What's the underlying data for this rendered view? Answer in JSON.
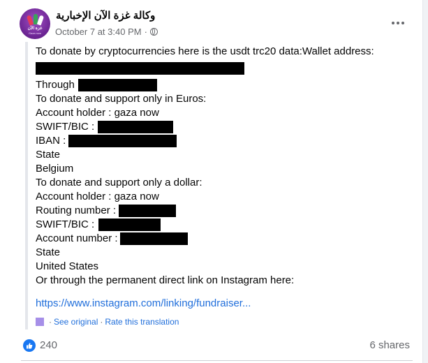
{
  "post": {
    "page_name": "وكالة غزة الآن الإخبارية",
    "avatar_text": "غزة الآن",
    "avatar_sub": "Gaza now",
    "date": "October 7 at 3:40 PM",
    "separator": "·",
    "lines": {
      "l1": "To donate by cryptocurrencies here is the usdt trc20 data:Wallet address:",
      "l2": "",
      "l3": "Through",
      "l4": "To donate and support only in Euros:",
      "l5": "Account holder : gaza now",
      "l6": "SWIFT/BIC :",
      "l7": "IBAN :",
      "l8": "State",
      "l9": "Belgium",
      "l10": "To donate and support only a dollar:",
      "l11": "Account holder : gaza now",
      "l12": "Routing number :",
      "l13": "SWIFT/BIC :",
      "l14": "Account number :",
      "l15": "State",
      "l16": "United States",
      "l17": "Or through the permanent direct link on Instagram here:"
    },
    "link": "https://www.instagram.com/linking/fundraiser...",
    "see_original": "See original",
    "dot": "·",
    "rate_translation": "Rate this translation"
  },
  "footer": {
    "like_count": "240",
    "shares": "6 shares"
  },
  "colors": {
    "link": "#216fdb",
    "like": "#1877f2",
    "translate_icon": "#a68fe8"
  }
}
